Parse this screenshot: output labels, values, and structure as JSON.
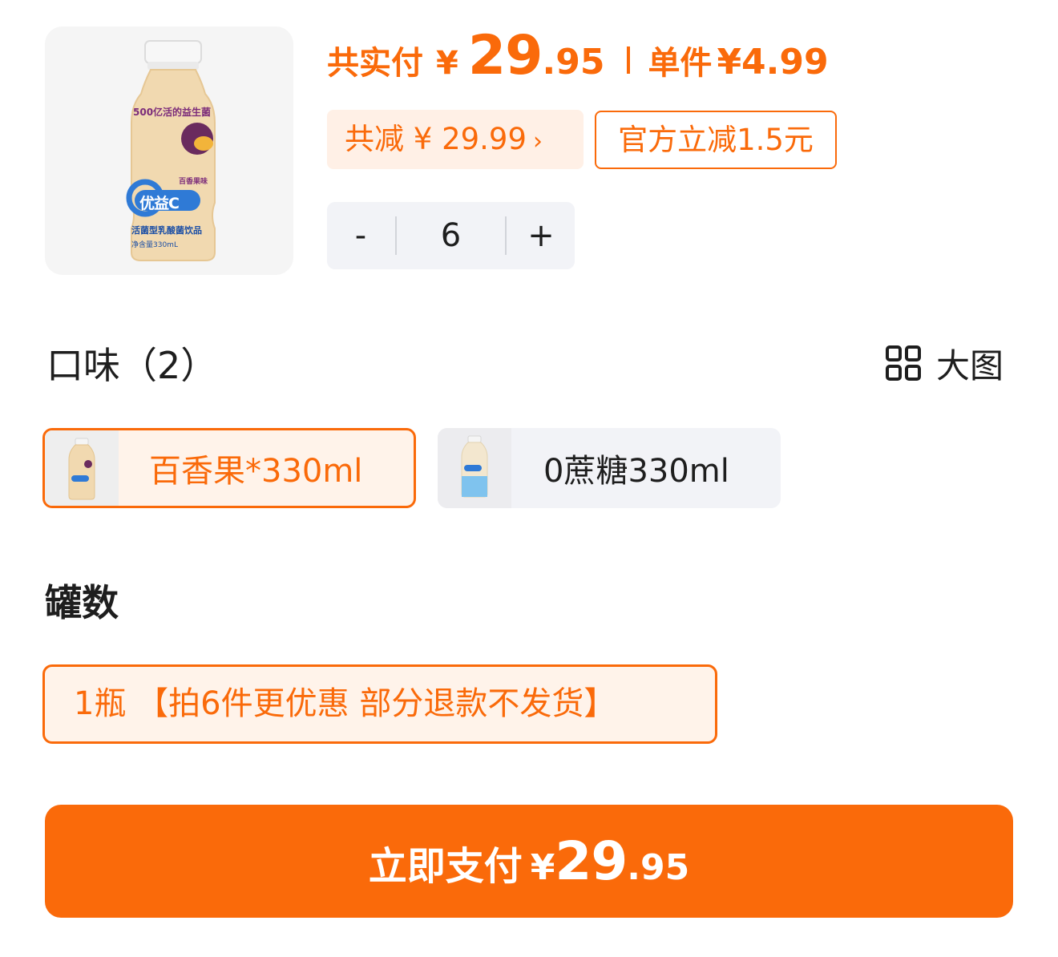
{
  "product": {
    "image_icon": "yogurt-drink-bottle-icon",
    "bottle_text": {
      "probiotic": "500亿活的益生菌",
      "flavor": "百香果味",
      "brand": "优益C",
      "type": "活菌型乳酸菌饮品",
      "volume": "净含量330mL"
    }
  },
  "price": {
    "label": "共实付",
    "currency": "¥",
    "integer": "29",
    "decimal": ".95",
    "unit_label": "单件",
    "unit_price": "¥4.99",
    "color": "#fa6a0a"
  },
  "badges": {
    "discount": "共减 ¥ 29.99",
    "discount_chevron": "›",
    "official": "官方立减1.5元"
  },
  "quantity": {
    "minus": "-",
    "value": "6",
    "plus": "+"
  },
  "flavor": {
    "title": "口味（2）",
    "view_toggle_icon": "grid-icon",
    "view_toggle_label": "大图",
    "options": [
      {
        "label": "百香果*330ml",
        "selected": true,
        "thumb_icon": "passion-fruit-bottle-icon"
      },
      {
        "label": "0蔗糖330ml",
        "selected": false,
        "thumb_icon": "zero-sugar-bottle-icon"
      }
    ]
  },
  "count": {
    "title": "罐数",
    "options": [
      {
        "label": "1瓶 【拍6件更优惠 部分退款不发货】",
        "selected": true
      }
    ]
  },
  "pay_button": {
    "label": "立即支付",
    "currency": "¥",
    "integer": "29",
    "decimal": ".95"
  }
}
